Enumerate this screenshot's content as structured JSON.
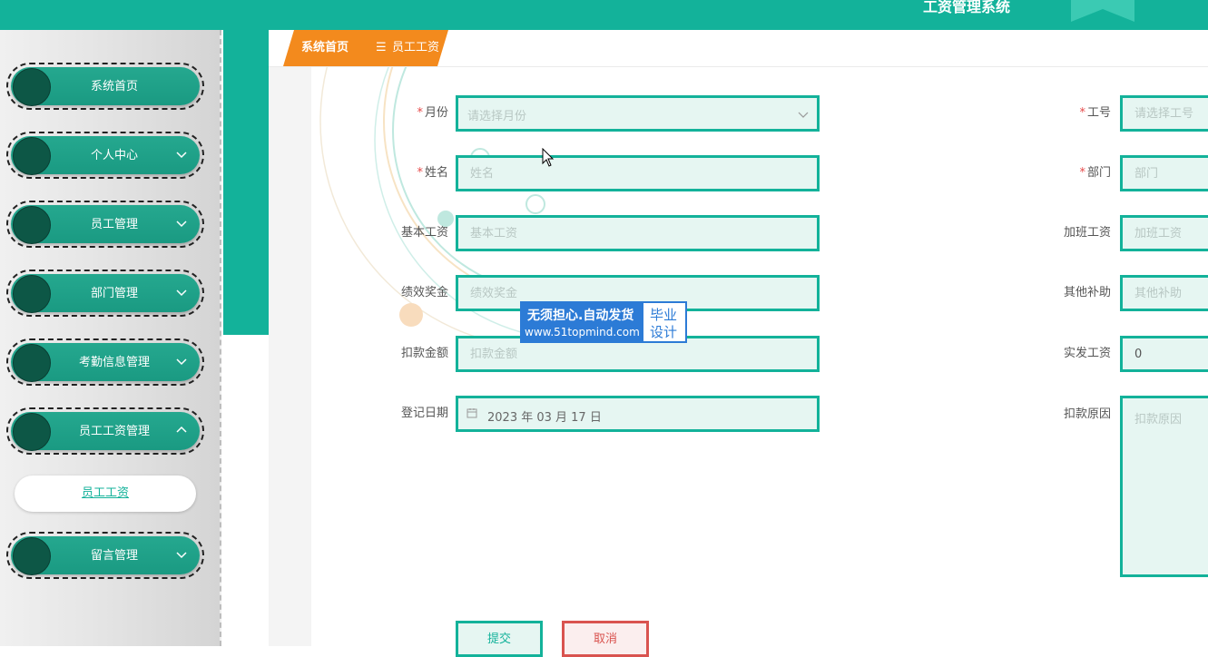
{
  "header": {
    "app_title": "工资管理系统"
  },
  "sidebar": {
    "items": [
      {
        "label": "系统首页",
        "has_chevron": false
      },
      {
        "label": "个人中心",
        "has_chevron": true,
        "chevron": "down"
      },
      {
        "label": "员工管理",
        "has_chevron": true,
        "chevron": "down"
      },
      {
        "label": "部门管理",
        "has_chevron": true,
        "chevron": "down"
      },
      {
        "label": "考勤信息管理",
        "has_chevron": true,
        "chevron": "down"
      },
      {
        "label": "员工工资管理",
        "has_chevron": true,
        "chevron": "up"
      },
      {
        "label": "留言管理",
        "has_chevron": true,
        "chevron": "down"
      }
    ],
    "active_sub_item": "员工工资"
  },
  "breadcrumb": {
    "home": "系统首页",
    "separator": "☰",
    "current": "员工工资"
  },
  "form": {
    "month": {
      "label": "月份",
      "required": true,
      "placeholder": "请选择月份"
    },
    "employee_no": {
      "label": "工号",
      "required": true,
      "placeholder": "请选择工号"
    },
    "name": {
      "label": "姓名",
      "required": true,
      "placeholder": "姓名"
    },
    "department": {
      "label": "部门",
      "required": true,
      "placeholder": "部门"
    },
    "base_salary": {
      "label": "基本工资",
      "placeholder": "基本工资"
    },
    "overtime_pay": {
      "label": "加班工资",
      "placeholder": "加班工资"
    },
    "performance_bonus": {
      "label": "绩效奖金",
      "placeholder": "绩效奖金"
    },
    "other_allowance": {
      "label": "其他补助",
      "placeholder": "其他补助"
    },
    "deduction": {
      "label": "扣款金额",
      "placeholder": "扣款金额"
    },
    "actual_salary": {
      "label": "实发工资",
      "value": "0"
    },
    "register_date": {
      "label": "登记日期",
      "value": "2023 年 03 月 17 日"
    },
    "deduction_reason": {
      "label": "扣款原因",
      "placeholder": "扣款原因"
    },
    "required_mark": "*"
  },
  "buttons": {
    "submit": "提交",
    "cancel": "取消"
  },
  "watermark": {
    "line1": "无须担心.自动发货",
    "line2": "www.51topmind.com",
    "right1": "毕业",
    "right2": "设计"
  },
  "colors": {
    "primary": "#13b29a",
    "accent": "#f38a1d",
    "danger": "#d9534f",
    "field_bg": "#e6f6f2"
  }
}
